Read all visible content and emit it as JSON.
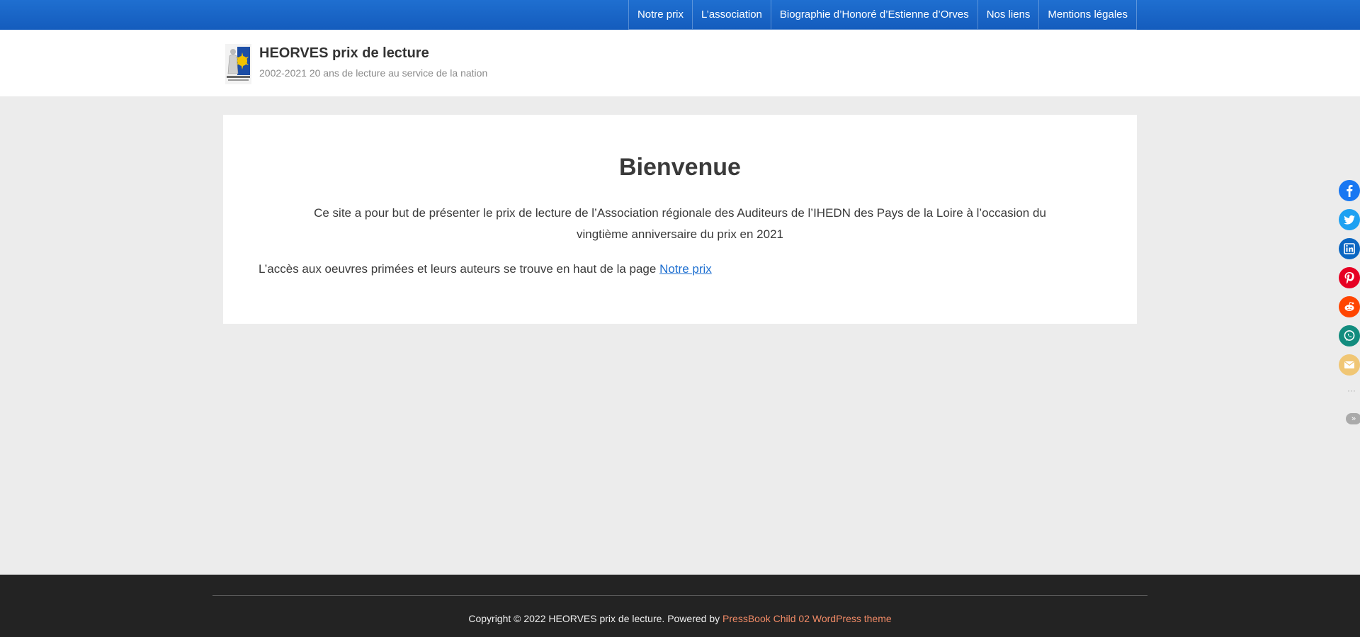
{
  "nav": {
    "items": [
      "Notre prix",
      "L’association",
      "Biographie d’Honoré d’Estienne d’Orves",
      "Nos liens",
      "Mentions légales"
    ]
  },
  "header": {
    "logo_icon": "association-emblem-icon",
    "title": "HEORVES prix de lecture",
    "tagline": "2002-2021 20 ans de lecture au service de la nation"
  },
  "main": {
    "heading": "Bienvenue",
    "intro": "Ce site a pour but de présenter le prix de lecture de l’Association régionale des Auditeurs de l’IHEDN des Pays de la Loire à l’occasion du vingtième anniversaire du prix en 2021",
    "access_text": "L’accès aux oeuvres primées et leurs auteurs se trouve en haut de la page ",
    "access_link": "Notre prix"
  },
  "footer": {
    "copyright": "Copyright © 2022 HEORVES prix de lecture. Powered by ",
    "theme_link": "PressBook Child 02 WordPress theme"
  },
  "share": {
    "buttons": [
      {
        "icon": "facebook-icon",
        "color": "#1877f2"
      },
      {
        "icon": "twitter-icon",
        "color": "#1da1f2"
      },
      {
        "icon": "linkedin-icon",
        "color": "#0a66c2"
      },
      {
        "icon": "pinterest-icon",
        "color": "#e60023"
      },
      {
        "icon": "reddit-icon",
        "color": "#ff4500"
      },
      {
        "icon": "whatsapp-icon",
        "color": "#128c7e"
      },
      {
        "icon": "email-icon",
        "color": "#f0c674"
      }
    ],
    "more_icon": "more-options-icon",
    "toggle_icon": "collapse-share-icon"
  },
  "colors": {
    "nav_bar": "#1a66c9",
    "link": "#1e6fd0",
    "footer_link": "#f08a66",
    "footer_bg": "#232323",
    "page_bg": "#ececec"
  }
}
